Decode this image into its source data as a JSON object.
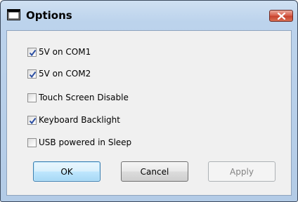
{
  "window": {
    "title": "Options",
    "icon": "window-icon",
    "close_icon": "close-icon"
  },
  "options": [
    {
      "label": "5V on COM1",
      "checked": true
    },
    {
      "label": "5V on COM2",
      "checked": true
    },
    {
      "label": "Touch Screen Disable",
      "checked": false
    },
    {
      "label": "Keyboard Backlight",
      "checked": true
    },
    {
      "label": "USB powered in Sleep",
      "checked": false
    }
  ],
  "buttons": {
    "ok": "OK",
    "cancel": "Cancel",
    "apply": "Apply"
  },
  "colors": {
    "checkmark": "#2c4fa3",
    "close_button": "#c7432f",
    "title_bar": "#bcd3ec"
  }
}
